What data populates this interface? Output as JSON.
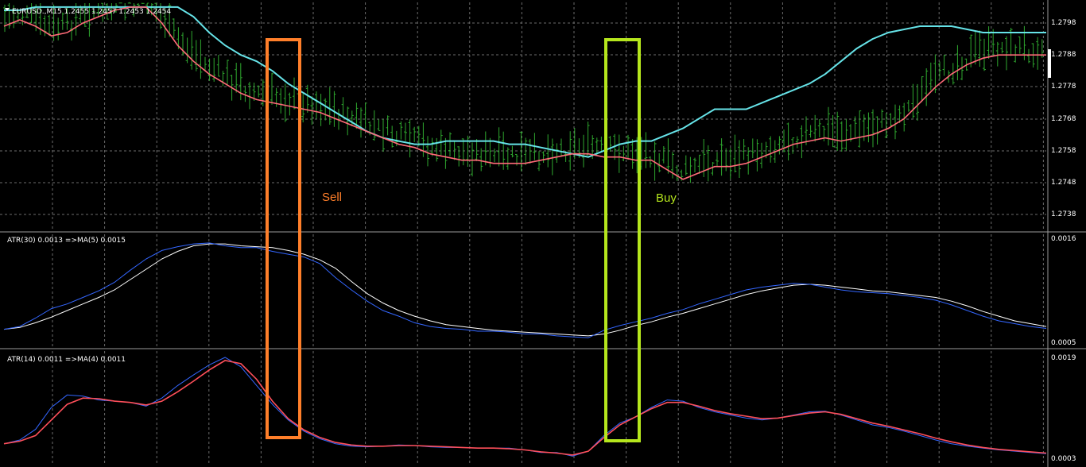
{
  "window": {
    "symbol_info": "EURUSD.,M15  1.2455 1.2457 1.2453 1.2454"
  },
  "price_panel": {
    "y_ticks": [
      "1.2798",
      "1.2788",
      "1.2778",
      "1.2768",
      "1.2758",
      "1.2748",
      "1.2738"
    ]
  },
  "atr30_panel": {
    "title": "ATR(30) 0.0013  =>MA(5) 0.0015",
    "y_max": "0.0016",
    "y_min": "0.0005"
  },
  "atr14_panel": {
    "title": "ATR(14) 0.0011  =>MA(4) 0.0011",
    "y_max": "0.0019",
    "y_min": "0.0003"
  },
  "annotations": {
    "sell_label": "Sell",
    "buy_label": "Buy",
    "sell_color": "#ff7f2a",
    "buy_color": "#b5e61d"
  },
  "colors": {
    "bars": "#2fa82f",
    "ma_fast": "#ff6a78",
    "ma_slow": "#66e3e8",
    "atr_line": "#3366ff",
    "atr30_ma": "#ffffff",
    "atr14_ma": "#ff4f5a",
    "grid": "#6b6b6b"
  },
  "chart_data": {
    "type": "line",
    "price_ma_fast": [
      1.2797,
      1.2799,
      1.2797,
      1.2794,
      1.2795,
      1.2798,
      1.28,
      1.2802,
      1.2803,
      1.2803,
      1.2798,
      1.2791,
      1.2786,
      1.2782,
      1.2779,
      1.2776,
      1.2774,
      1.2773,
      1.2772,
      1.2771,
      1.277,
      1.2768,
      1.2766,
      1.2764,
      1.2762,
      1.276,
      1.2759,
      1.2757,
      1.2756,
      1.2755,
      1.2755,
      1.2754,
      1.2754,
      1.2754,
      1.2755,
      1.2756,
      1.2757,
      1.2757,
      1.2756,
      1.2756,
      1.2755,
      1.2755,
      1.2752,
      1.2749,
      1.2751,
      1.2753,
      1.2753,
      1.2754,
      1.2756,
      1.2758,
      1.276,
      1.2761,
      1.2762,
      1.2761,
      1.2762,
      1.2763,
      1.2765,
      1.2768,
      1.2773,
      1.2778,
      1.2782,
      1.2785,
      1.2787,
      1.2788,
      1.2788,
      1.2788,
      1.2788
    ],
    "price_ma_slow": [
      1.2802,
      1.2802,
      1.2803,
      1.2803,
      1.2803,
      1.2803,
      1.2803,
      1.2803,
      1.2803,
      1.2803,
      1.2803,
      1.2803,
      1.28,
      1.2795,
      1.2791,
      1.2788,
      1.2786,
      1.2783,
      1.2779,
      1.2776,
      1.2773,
      1.277,
      1.2767,
      1.2764,
      1.2762,
      1.2761,
      1.276,
      1.276,
      1.2761,
      1.2761,
      1.2761,
      1.2761,
      1.276,
      1.276,
      1.2759,
      1.2758,
      1.2757,
      1.2756,
      1.2758,
      1.276,
      1.2761,
      1.2761,
      1.2763,
      1.2765,
      1.2768,
      1.2771,
      1.2771,
      1.2771,
      1.2773,
      1.2775,
      1.2777,
      1.2779,
      1.2782,
      1.2786,
      1.279,
      1.2793,
      1.2795,
      1.2796,
      1.2797,
      1.2797,
      1.2797,
      1.2796,
      1.2795,
      1.2795,
      1.2795,
      1.2795,
      1.2795
    ],
    "atr30": [
      0.00063,
      0.00066,
      0.00075,
      0.00085,
      0.0009,
      0.00097,
      0.00104,
      0.00113,
      0.00126,
      0.00138,
      0.00147,
      0.00151,
      0.00154,
      0.00155,
      0.00152,
      0.0015,
      0.0015,
      0.00146,
      0.00143,
      0.0014,
      0.00133,
      0.00118,
      0.00105,
      0.00093,
      0.00083,
      0.00077,
      0.0007,
      0.00066,
      0.00064,
      0.00063,
      0.00061,
      0.00061,
      0.0006,
      0.00058,
      0.00058,
      0.00056,
      0.00055,
      0.00054,
      0.00062,
      0.00067,
      0.00071,
      0.00075,
      0.0008,
      0.00084,
      0.0009,
      0.00095,
      0.001,
      0.00105,
      0.00108,
      0.0011,
      0.00112,
      0.00111,
      0.00108,
      0.00105,
      0.00103,
      0.00102,
      0.00101,
      0.00099,
      0.00097,
      0.00094,
      0.00089,
      0.00083,
      0.00077,
      0.00072,
      0.00069,
      0.00066,
      0.00064
    ],
    "atr30_ma": [
      0.00063,
      0.00065,
      0.0007,
      0.00076,
      0.00083,
      0.0009,
      0.00097,
      0.00105,
      0.00116,
      0.00127,
      0.00138,
      0.00146,
      0.00152,
      0.00154,
      0.00154,
      0.00152,
      0.00151,
      0.0015,
      0.00147,
      0.00143,
      0.00137,
      0.00128,
      0.00114,
      0.00101,
      0.00091,
      0.00083,
      0.00077,
      0.00072,
      0.00068,
      0.00066,
      0.00064,
      0.00062,
      0.00061,
      0.0006,
      0.00059,
      0.00058,
      0.00057,
      0.00056,
      0.00058,
      0.00062,
      0.00067,
      0.00071,
      0.00076,
      0.0008,
      0.00085,
      0.0009,
      0.00095,
      0.001,
      0.00104,
      0.00107,
      0.0011,
      0.00111,
      0.0011,
      0.00108,
      0.00106,
      0.00104,
      0.00103,
      0.00101,
      0.00099,
      0.00097,
      0.00093,
      0.00088,
      0.00082,
      0.00077,
      0.00072,
      0.00069,
      0.00066
    ],
    "atr14": [
      0.00052,
      0.00058,
      0.00075,
      0.0011,
      0.0013,
      0.00128,
      0.00122,
      0.0012,
      0.00118,
      0.00112,
      0.00125,
      0.00145,
      0.00162,
      0.00178,
      0.0019,
      0.00175,
      0.00145,
      0.00115,
      0.0009,
      0.00072,
      0.0006,
      0.00052,
      0.00048,
      0.00047,
      0.00048,
      0.0005,
      0.00049,
      0.00047,
      0.00046,
      0.00046,
      0.00045,
      0.00045,
      0.00045,
      0.00042,
      0.00038,
      0.00038,
      0.00032,
      0.0004,
      0.00065,
      0.00085,
      0.00095,
      0.0011,
      0.00122,
      0.0012,
      0.0011,
      0.00103,
      0.00098,
      0.00093,
      0.0009,
      0.00093,
      0.00098,
      0.00103,
      0.00104,
      0.00098,
      0.0009,
      0.00082,
      0.00078,
      0.00072,
      0.00065,
      0.00058,
      0.00052,
      0.00048,
      0.00045,
      0.00042,
      0.0004,
      0.00038,
      0.00036
    ],
    "atr14_ma": [
      0.00052,
      0.00056,
      0.00065,
      0.0009,
      0.00115,
      0.00125,
      0.00124,
      0.0012,
      0.00118,
      0.00114,
      0.0012,
      0.00135,
      0.00152,
      0.0017,
      0.00185,
      0.0018,
      0.00155,
      0.0012,
      0.00092,
      0.00074,
      0.00062,
      0.00054,
      0.0005,
      0.00048,
      0.00048,
      0.00049,
      0.00049,
      0.00048,
      0.00047,
      0.00046,
      0.00045,
      0.00045,
      0.00044,
      0.00042,
      0.00039,
      0.00037,
      0.00034,
      0.0004,
      0.00062,
      0.00082,
      0.00095,
      0.00108,
      0.00118,
      0.00118,
      0.00112,
      0.00105,
      0.001,
      0.00096,
      0.00092,
      0.00093,
      0.00097,
      0.00101,
      0.00103,
      0.00099,
      0.00092,
      0.00085,
      0.0008,
      0.00074,
      0.00068,
      0.00061,
      0.00055,
      0.0005,
      0.00046,
      0.00043,
      0.00041,
      0.00039,
      0.00037
    ]
  }
}
